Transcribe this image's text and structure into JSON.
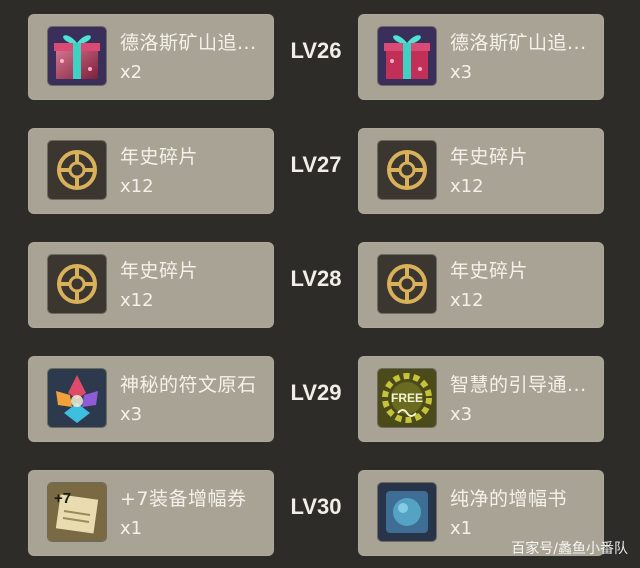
{
  "rows": [
    {
      "level": "LV26",
      "left": {
        "icon": "gift-box-icon",
        "name": "德洛斯矿山追...",
        "qty": "x2"
      },
      "right": {
        "icon": "gift-box-icon",
        "name": "德洛斯矿山追...",
        "qty": "x3"
      }
    },
    {
      "level": "LV27",
      "left": {
        "icon": "chronicle-coin-icon",
        "name": "年史碎片",
        "qty": "x12"
      },
      "right": {
        "icon": "chronicle-coin-icon",
        "name": "年史碎片",
        "qty": "x12"
      }
    },
    {
      "level": "LV28",
      "left": {
        "icon": "chronicle-coin-icon",
        "name": "年史碎片",
        "qty": "x12"
      },
      "right": {
        "icon": "chronicle-coin-icon",
        "name": "年史碎片",
        "qty": "x12"
      }
    },
    {
      "level": "LV29",
      "left": {
        "icon": "rune-stone-icon",
        "name": "神秘的符文原石",
        "qty": "x3"
      },
      "right": {
        "icon": "free-ticket-icon",
        "name": "智慧的引导通...",
        "qty": "x3"
      }
    },
    {
      "level": "LV30",
      "left": {
        "icon": "amplify-voucher-icon",
        "name": "+7装备增幅券",
        "qty": "x1"
      },
      "right": {
        "icon": "amplify-book-icon",
        "name": "纯净的增幅书",
        "qty": "x1"
      }
    }
  ],
  "icon_texts": {
    "plus7": "+7",
    "free": "FREE"
  },
  "watermark": "百家号/蠡鱼小番队"
}
